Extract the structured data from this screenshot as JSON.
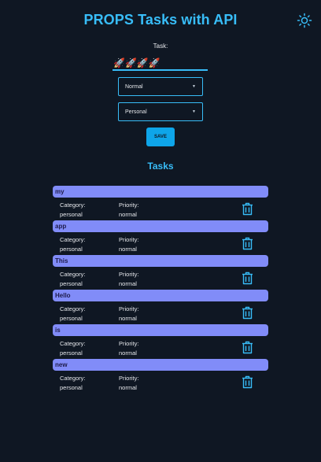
{
  "header": {
    "title": "PROPS Tasks with API",
    "theme_icon": "sun-icon"
  },
  "form": {
    "task_label": "Task:",
    "task_value": "🚀🚀🚀🚀",
    "priority_select": "Normal",
    "category_select": "Personal",
    "save_label": "SAVE"
  },
  "tasks_heading": "Tasks",
  "tasks": [
    {
      "name": "my",
      "category_label": "Category:",
      "category": "personal",
      "priority_label": "Priority:",
      "priority": "normal"
    },
    {
      "name": "app",
      "category_label": "Category:",
      "category": "personal",
      "priority_label": "Priority:",
      "priority": "normal"
    },
    {
      "name": "This",
      "category_label": "Category:",
      "category": "personal",
      "priority_label": "Priority:",
      "priority": "normal"
    },
    {
      "name": "Hello",
      "category_label": "Category:",
      "category": "personal",
      "priority_label": "Priority:",
      "priority": "normal"
    },
    {
      "name": "is",
      "category_label": "Category:",
      "category": "personal",
      "priority_label": "Priority:",
      "priority": "normal"
    },
    {
      "name": "new",
      "category_label": "Category:",
      "category": "personal",
      "priority_label": "Priority:",
      "priority": "normal"
    }
  ],
  "colors": {
    "background": "#0f1723",
    "accent": "#38bdf8",
    "task_header": "#818cf8"
  }
}
